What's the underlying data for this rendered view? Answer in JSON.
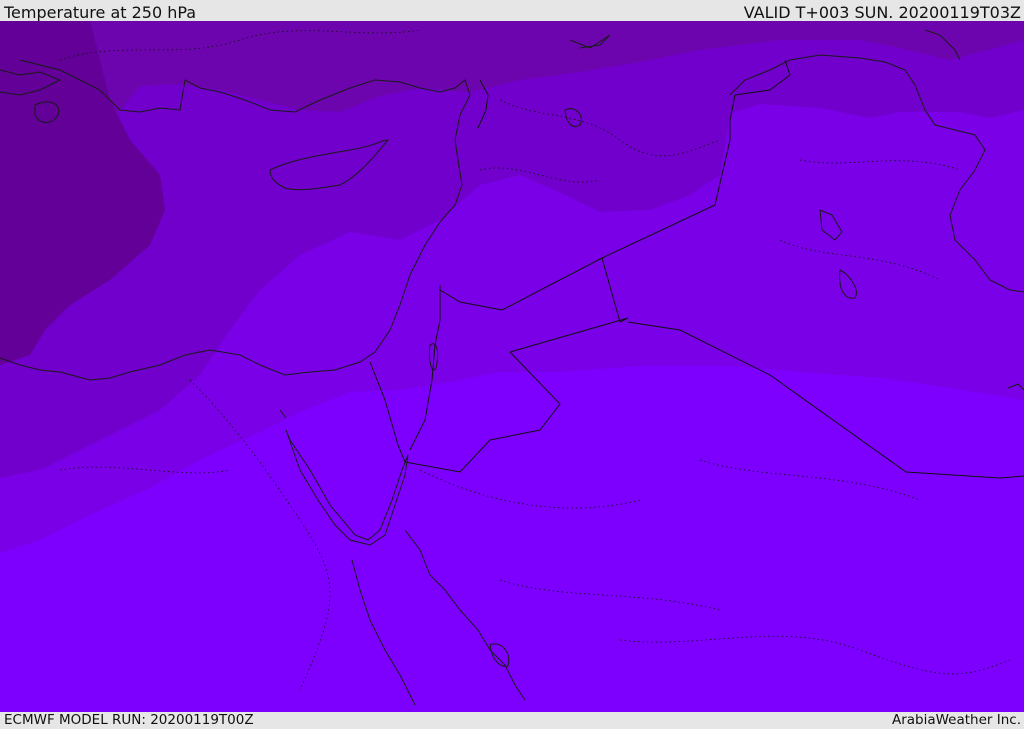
{
  "header": {
    "title": "Temperature at 250 hPa",
    "valid_time": "VALID T+003 SUN. 20200119T03Z"
  },
  "footer": {
    "model_run": "ECMWF MODEL RUN: 20200119T00Z",
    "credit": "ArabiaWeather Inc."
  },
  "map": {
    "variable": "Temperature",
    "level": "250 hPa",
    "colors": {
      "band_coldest": "#620097",
      "band_cold": "#6d05ae",
      "band_mid": "#7100cc",
      "band_warm": "#7a00e8",
      "band_warmest": "#7d00ff",
      "coastline": "#1a1a1a",
      "border": "#111111"
    }
  }
}
